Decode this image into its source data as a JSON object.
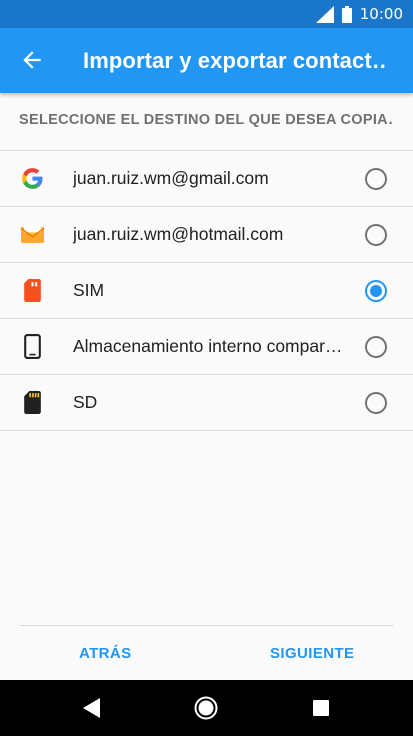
{
  "status_bar": {
    "time": "10:00"
  },
  "app_bar": {
    "title": "Importar y exportar contact…"
  },
  "section_header": "SELECCIONE EL DESTINO DEL QUE DESEA COPIA…",
  "options": [
    {
      "label": "juan.ruiz.wm@gmail.com",
      "icon": "google-icon",
      "selected": false
    },
    {
      "label": "juan.ruiz.wm@hotmail.com",
      "icon": "email-icon",
      "selected": false
    },
    {
      "label": "SIM",
      "icon": "sim-card-icon",
      "selected": true
    },
    {
      "label": "Almacenamiento interno compar…",
      "icon": "phone-icon",
      "selected": false
    },
    {
      "label": "SD",
      "icon": "sd-card-icon",
      "selected": false
    }
  ],
  "footer": {
    "back_label": "ATRÁS",
    "next_label": "SIGUIENTE"
  },
  "colors": {
    "primary": "#2196f3",
    "status_bar": "#1976c8",
    "accent": "#2196f3"
  }
}
